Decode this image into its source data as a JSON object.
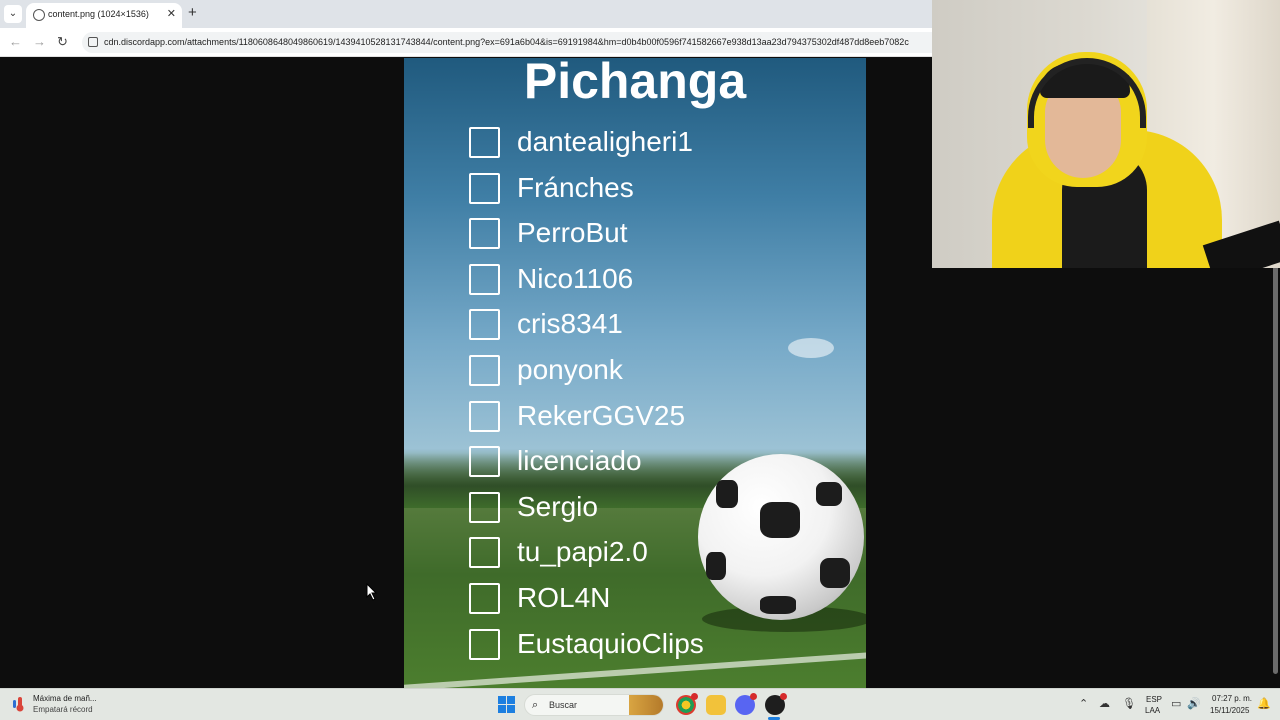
{
  "browser": {
    "tab_title": "content.png (1024×1536)",
    "url": "cdn.discordapp.com/attachments/1180608648049860619/1439410528131743844/content.png?ex=691a6b04&is=69191984&hm=d0b4b00f0596f741582667e938d13aa23d794375302df487dd8eeb7082c"
  },
  "poster": {
    "title": "Pichanga",
    "players": [
      {
        "name": "dantealigheri1",
        "checked": false
      },
      {
        "name": "Fránches",
        "checked": false
      },
      {
        "name": "PerroBut",
        "checked": false
      },
      {
        "name": "Nico1106",
        "checked": false
      },
      {
        "name": "cris8341",
        "checked": false
      },
      {
        "name": "ponyonk",
        "checked": false
      },
      {
        "name": "RekerGGV25",
        "checked": false
      },
      {
        "name": "licenciado",
        "checked": false
      },
      {
        "name": "Sergio",
        "checked": false
      },
      {
        "name": "tu_papi2.0",
        "checked": false
      },
      {
        "name": "ROL4N",
        "checked": false
      },
      {
        "name": "EustaquioClips",
        "checked": false
      }
    ]
  },
  "taskbar": {
    "weather_title": "Máxima de mañ...",
    "weather_subtitle": "Empatará récord",
    "search_placeholder": "Buscar",
    "lang_line1": "ESP",
    "lang_line2": "LAA",
    "time": "07:27 p. m.",
    "date": "15/11/2025",
    "accent": "#1d7fe0"
  }
}
